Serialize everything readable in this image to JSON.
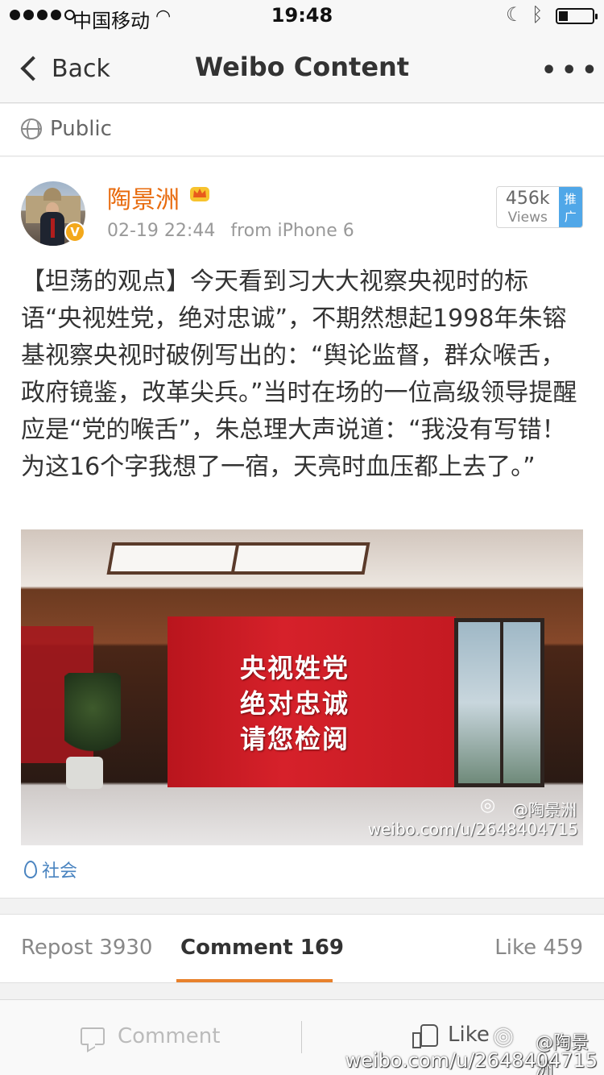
{
  "status_bar": {
    "carrier": "中国移动",
    "time": "19:48"
  },
  "nav": {
    "back_label": "Back",
    "title": "Weibo Content",
    "more_label": "•••"
  },
  "visibility": {
    "label": "Public"
  },
  "post": {
    "author": "陶景洲",
    "verified_badge": "V",
    "timestamp": "02-19 22:44",
    "source": "from iPhone 6",
    "views": {
      "count": "456k",
      "label": "Views",
      "promo": "推广"
    },
    "text": "【坦荡的观点】今天看到习大大视察央视时的标语“央视姓党，绝对忠诚”，不期然想起1998年朱镕基视察央视时破例写出的：“舆论监督，群众喉舌，政府镜鉴，改革尖兵。”当时在场的一位高级领导提醒应是“党的喉舌”，朱总理大声说道：“我没有写错！为这16个字我想了一宿，天亮时血压都上去了。”",
    "image": {
      "screen_line1": "央视姓党",
      "screen_line2": "绝对忠诚",
      "screen_line3": "请您检阅",
      "watermark_user": "@陶景洲",
      "watermark_url": "weibo.com/u/2648404715"
    },
    "topic": "社会"
  },
  "tabs": {
    "repost": "Repost 3930",
    "comment": "Comment 169",
    "like": "Like 459"
  },
  "bottom_bar": {
    "comment": "Comment",
    "like": "Like"
  },
  "page_watermark": {
    "user": "@陶景洲",
    "url": "weibo.com/u/2648404715"
  },
  "colors": {
    "author_name": "#e86b0e",
    "promo_badge": "#50a7e8",
    "tab_underline": "#e8812c",
    "topic_link": "#4a84c0",
    "screen_red": "#d6212a"
  }
}
